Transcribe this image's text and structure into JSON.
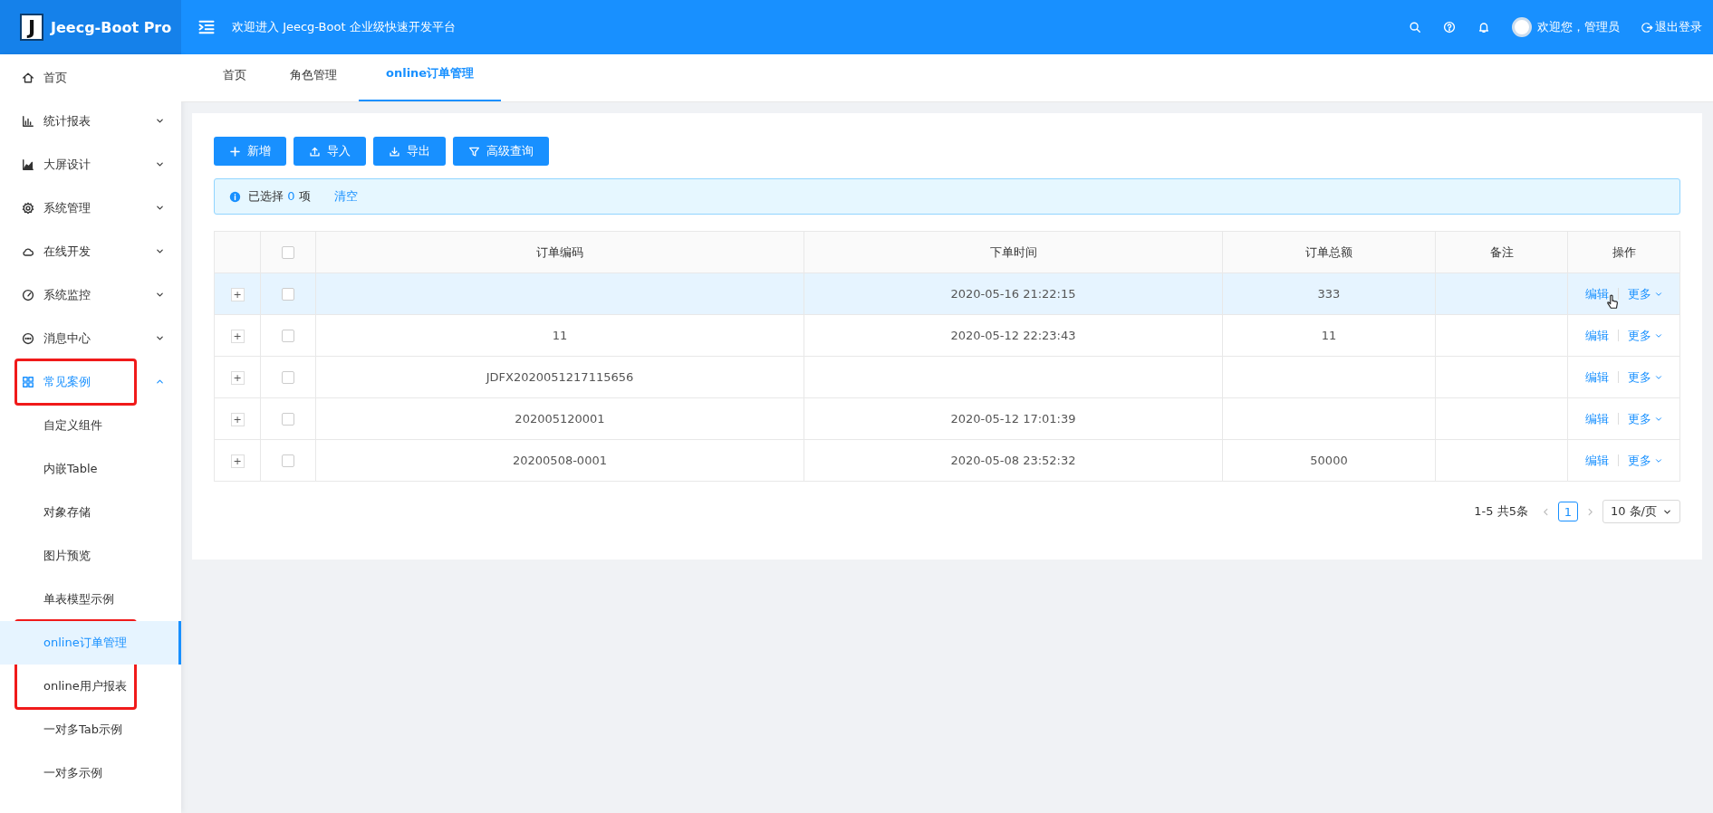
{
  "header": {
    "logo_letter": "J",
    "app_name": "Jeecg-Boot Pro",
    "welcome_text": "欢迎进入 Jeecg-Boot 企业级快速开发平台",
    "user_greeting": "欢迎您，管理员",
    "logout": "退出登录"
  },
  "sidebar": {
    "items": [
      {
        "label": "首页",
        "kind": "item",
        "selected": false,
        "boxed": false
      },
      {
        "label": "统计报表",
        "kind": "group",
        "expanded": false,
        "selected": false,
        "boxed": false
      },
      {
        "label": "大屏设计",
        "kind": "group",
        "expanded": false,
        "selected": false,
        "boxed": false
      },
      {
        "label": "系统管理",
        "kind": "group",
        "expanded": false,
        "selected": false,
        "boxed": false
      },
      {
        "label": "在线开发",
        "kind": "group",
        "expanded": false,
        "selected": false,
        "boxed": false
      },
      {
        "label": "系统监控",
        "kind": "group",
        "expanded": false,
        "selected": false,
        "boxed": false
      },
      {
        "label": "消息中心",
        "kind": "group",
        "expanded": false,
        "selected": false,
        "boxed": false
      },
      {
        "label": "常见案例",
        "kind": "group",
        "expanded": true,
        "selected": false,
        "boxed": true
      },
      {
        "label": "自定义组件",
        "kind": "sub",
        "selected": false,
        "boxed": false
      },
      {
        "label": "内嵌Table",
        "kind": "sub",
        "selected": false,
        "boxed": false
      },
      {
        "label": "对象存储",
        "kind": "sub",
        "selected": false,
        "boxed": false
      },
      {
        "label": "图片预览",
        "kind": "sub",
        "selected": false,
        "boxed": false
      },
      {
        "label": "单表模型示例",
        "kind": "sub",
        "selected": false,
        "boxed": false
      },
      {
        "label": "online订单管理",
        "kind": "sub",
        "selected": true,
        "boxed": true
      },
      {
        "label": "online用户报表",
        "kind": "sub",
        "selected": false,
        "boxed": true
      },
      {
        "label": "一对多Tab示例",
        "kind": "sub",
        "selected": false,
        "boxed": false
      },
      {
        "label": "一对多示例",
        "kind": "sub",
        "selected": false,
        "boxed": false
      }
    ]
  },
  "tabs": [
    {
      "label": "首页",
      "selected": false
    },
    {
      "label": "角色管理",
      "selected": false
    },
    {
      "label": "online订单管理",
      "selected": true
    }
  ],
  "toolbar": [
    {
      "label": "新增"
    },
    {
      "label": "导入"
    },
    {
      "label": "导出"
    },
    {
      "label": "高级查询"
    }
  ],
  "selection_alert": {
    "prefix": "已选择",
    "count": "0",
    "suffix": "项",
    "clear": "清空"
  },
  "table": {
    "columns": [
      "订单编码",
      "下单时间",
      "订单总额",
      "备注",
      "操作"
    ],
    "all_checked": false,
    "rows": [
      {
        "expand": "+",
        "time": "2020-05-16 21:22:15",
        "total": "333",
        "checked": false,
        "hovered": true,
        "edit": "编辑",
        "more": "更多"
      },
      {
        "expand": "+",
        "code": "11",
        "time": "2020-05-12 22:23:43",
        "total": "11",
        "checked": false,
        "hovered": false,
        "edit": "编辑",
        "more": "更多"
      },
      {
        "expand": "+",
        "code": "JDFX2020051217115656",
        "checked": false,
        "hovered": false,
        "edit": "编辑",
        "more": "更多"
      },
      {
        "expand": "+",
        "code": "202005120001",
        "time": "2020-05-12 17:01:39",
        "checked": false,
        "hovered": false,
        "edit": "编辑",
        "more": "更多"
      },
      {
        "expand": "+",
        "code": "20200508-0001",
        "time": "2020-05-08 23:52:32",
        "total": "50000",
        "checked": false,
        "hovered": false,
        "edit": "编辑",
        "more": "更多"
      }
    ]
  },
  "pagination": {
    "summary": "1-5 共5条",
    "pages": [
      {
        "label": "1",
        "selected": true
      }
    ],
    "page_size": "10 条/页"
  }
}
